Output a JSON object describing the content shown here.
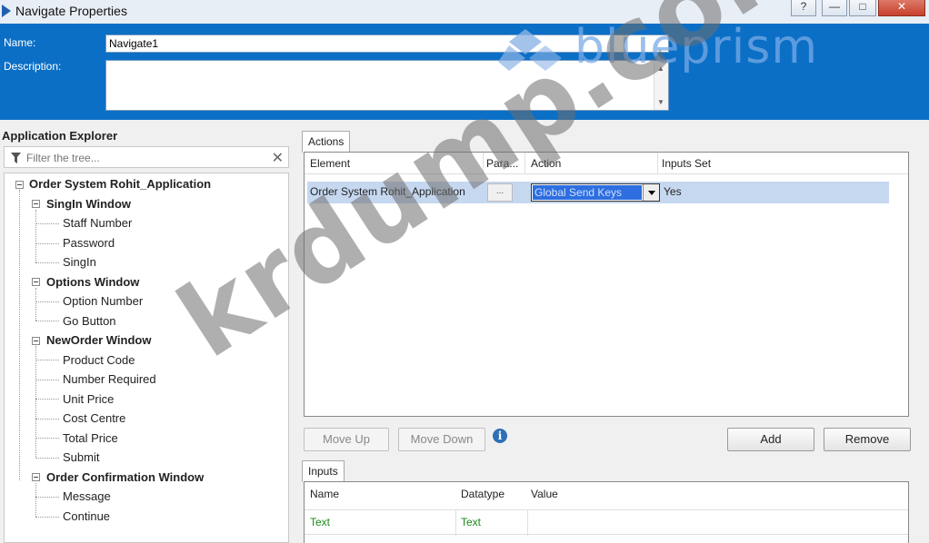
{
  "window": {
    "title": "Navigate Properties",
    "controls": {
      "help": "?",
      "minimize": "—",
      "maximize": "□",
      "close": "✕"
    }
  },
  "header": {
    "name_label": "Name:",
    "name_value": "Navigate1",
    "description_label": "Description:",
    "description_value": "",
    "logo_text": "blueprism"
  },
  "explorer": {
    "title": "Application Explorer",
    "filter_placeholder": "Filter the tree...",
    "tree": [
      {
        "label": "Order System Rohit_Application",
        "level": 0,
        "bold": true,
        "expanded": true
      },
      {
        "label": "SingIn Window",
        "level": 1,
        "bold": true,
        "expanded": true
      },
      {
        "label": "Staff Number",
        "level": 2
      },
      {
        "label": "Password",
        "level": 2
      },
      {
        "label": "SingIn",
        "level": 2
      },
      {
        "label": "Options Window",
        "level": 1,
        "bold": true,
        "expanded": true
      },
      {
        "label": "Option Number",
        "level": 2
      },
      {
        "label": "Go Button",
        "level": 2
      },
      {
        "label": "NewOrder Window",
        "level": 1,
        "bold": true,
        "expanded": true
      },
      {
        "label": "Product Code",
        "level": 2
      },
      {
        "label": "Number Required",
        "level": 2
      },
      {
        "label": "Unit Price",
        "level": 2
      },
      {
        "label": "Cost Centre",
        "level": 2
      },
      {
        "label": "Total Price",
        "level": 2
      },
      {
        "label": "Submit",
        "level": 2
      },
      {
        "label": "Order Confirmation Window",
        "level": 1,
        "bold": true,
        "expanded": true
      },
      {
        "label": "Message",
        "level": 2
      },
      {
        "label": "Continue",
        "level": 2
      }
    ]
  },
  "actions": {
    "tab_label": "Actions",
    "columns": [
      "Element",
      "Para...",
      "Action",
      "Inputs Set"
    ],
    "rows": [
      {
        "element": "Order System Rohit_Application",
        "params": "...",
        "action": "Global Send Keys",
        "inputs_set": "Yes"
      }
    ],
    "buttons": {
      "move_up": "Move Up",
      "move_down": "Move Down",
      "info": "i",
      "add": "Add",
      "remove": "Remove"
    }
  },
  "inputs": {
    "tab_label": "Inputs",
    "columns": [
      "Name",
      "Datatype",
      "Value"
    ],
    "rows": [
      {
        "name": "Text",
        "datatype": "Text",
        "value": ""
      }
    ]
  },
  "watermark": "krdump.com",
  "colors": {
    "header_blue": "#0b6fc6",
    "selection_blue": "#c6d8f0",
    "input_green": "#1a8a1a"
  }
}
